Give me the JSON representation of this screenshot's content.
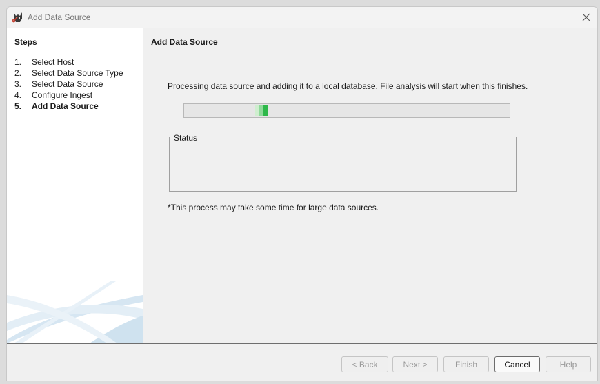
{
  "window": {
    "title": "Add Data Source"
  },
  "steps": {
    "heading": "Steps",
    "items": [
      {
        "num": "1.",
        "label": "Select Host"
      },
      {
        "num": "2.",
        "label": "Select Data Source Type"
      },
      {
        "num": "3.",
        "label": "Select Data Source"
      },
      {
        "num": "4.",
        "label": "Configure Ingest"
      },
      {
        "num": "5.",
        "label": "Add Data Source"
      }
    ],
    "active_index": 4
  },
  "main": {
    "heading": "Add Data Source",
    "processing_message": "Processing data source and adding it to a local database. File analysis will start when this finishes.",
    "progress": {
      "mode": "indeterminate",
      "color": "#2eb84a"
    },
    "status": {
      "label": "Status",
      "text": ""
    },
    "note": "*This process may take some time for large data sources."
  },
  "buttons": {
    "back": "< Back",
    "next": "Next >",
    "finish": "Finish",
    "cancel": "Cancel",
    "help": "Help"
  },
  "icons": {
    "app": "autopsy-dog-icon",
    "close": "close-icon"
  }
}
